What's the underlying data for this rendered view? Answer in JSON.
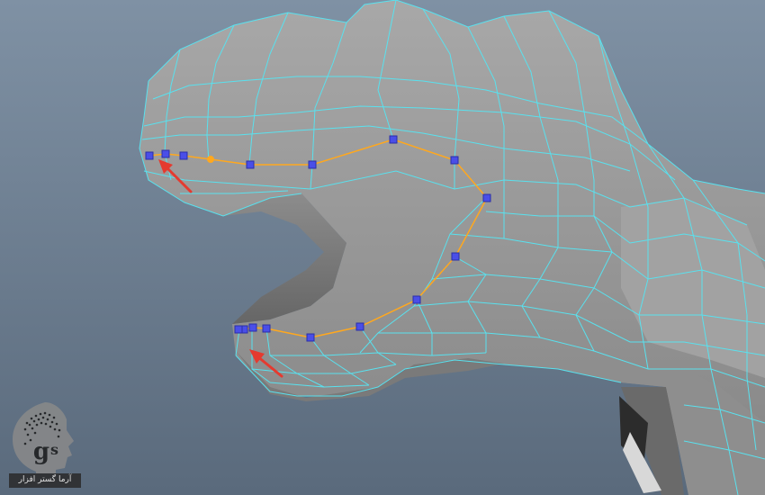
{
  "viewport": {
    "label": "Maya perspective viewport",
    "background_top": "#7f91a4",
    "background_bottom": "#5a6a7c"
  },
  "model": {
    "name": "dinosaur head low-poly mesh",
    "mesh_color": "#9a9a9a",
    "wire_color": "#59e1ee",
    "selected_edge_color": "#ffa81e",
    "selected_vertex_color": "#4a4ee8"
  },
  "annotations": [
    {
      "name": "arrow-upper-lip",
      "color": "#e53a2f"
    },
    {
      "name": "arrow-lower-lip",
      "color": "#e53a2f"
    }
  ],
  "watermark": {
    "logo_icon": "gearhead-logo-icon",
    "caption": "آرما گستر افزار",
    "badge_color": "#8a8a8a"
  }
}
